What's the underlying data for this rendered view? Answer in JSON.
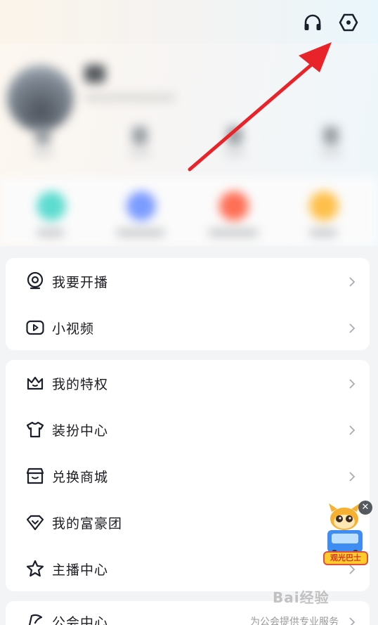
{
  "header": {
    "headphone_icon": "headphone-icon",
    "settings_icon": "settings-hexagon-icon"
  },
  "annotation": {
    "arrow_color": "#e8232a"
  },
  "groups": [
    {
      "items": [
        {
          "label": "我要开播",
          "icon": "live-broadcast-icon"
        },
        {
          "label": "小视频",
          "icon": "video-play-icon"
        }
      ]
    },
    {
      "items": [
        {
          "label": "我的特权",
          "icon": "crown-icon"
        },
        {
          "label": "装扮中心",
          "icon": "tshirt-icon"
        },
        {
          "label": "兑换商城",
          "icon": "store-icon"
        },
        {
          "label": "我的富豪团",
          "icon": "diamond-icon"
        },
        {
          "label": "主播中心",
          "icon": "star-icon"
        }
      ]
    },
    {
      "items": [
        {
          "label": "公会中心",
          "icon": "flag-icon",
          "extra": "为公会提供专业服务"
        }
      ]
    }
  ],
  "promo": {
    "close": "✕",
    "label": "观光巴士"
  },
  "watermark": "Bai经验"
}
